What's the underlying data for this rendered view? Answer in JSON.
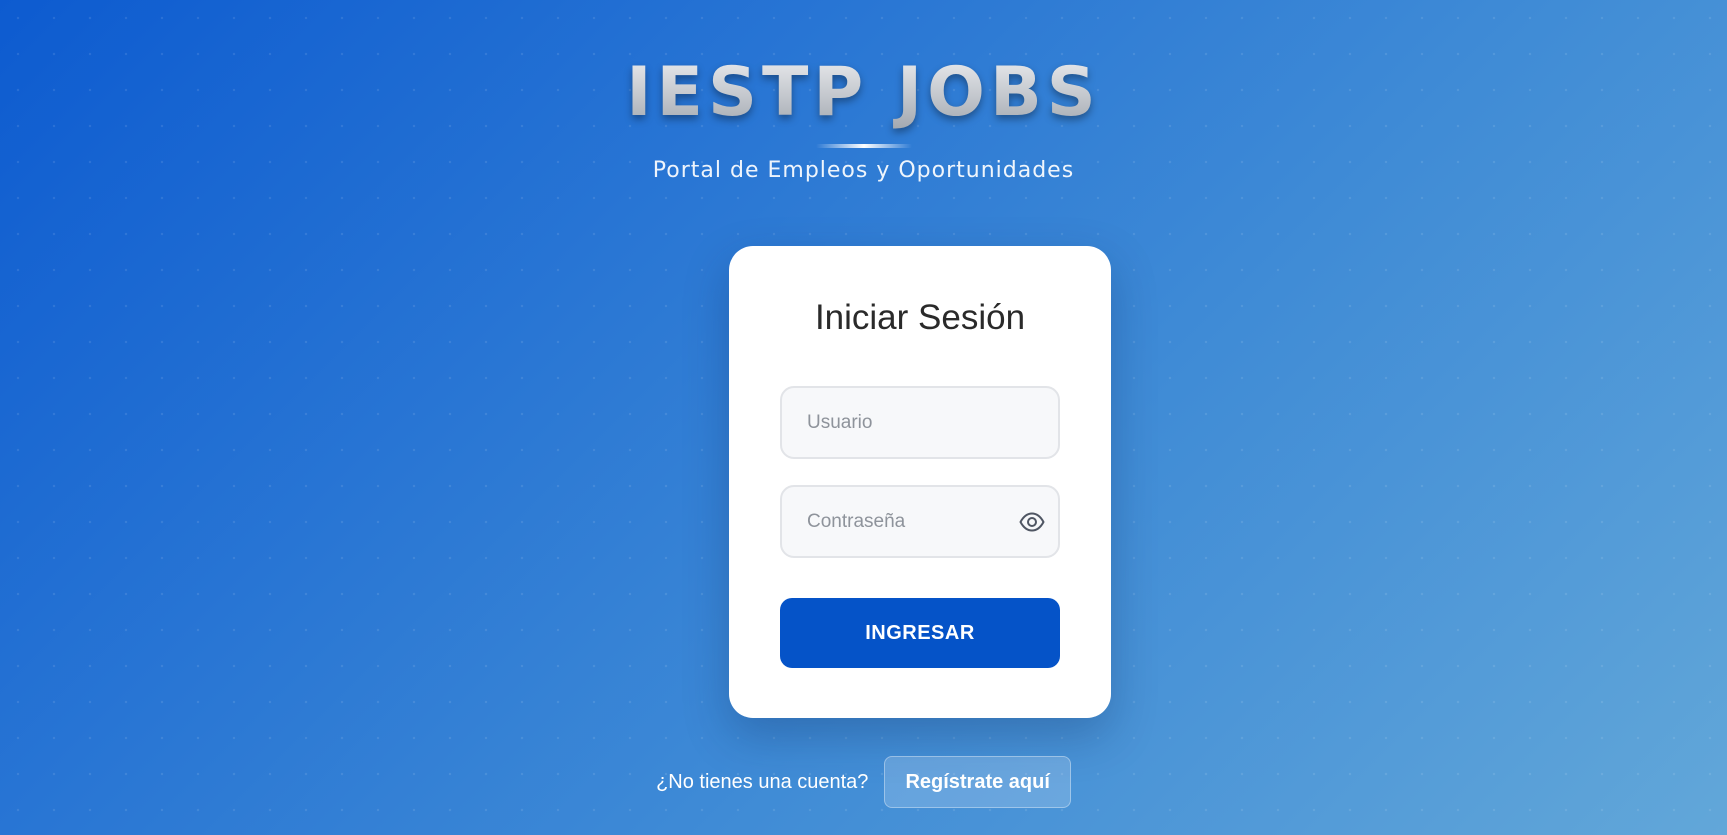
{
  "brand": {
    "title": "IESTP JOBS",
    "subtitle": "Portal de Empleos y Oportunidades"
  },
  "login": {
    "title": "Iniciar Sesión",
    "username_placeholder": "Usuario",
    "password_placeholder": "Contraseña",
    "show_password_icon": "eye-icon",
    "submit_label": "INGRESAR"
  },
  "register": {
    "prompt": "¿No tienes una cuenta?",
    "link_label": "Regístrate aquí"
  },
  "colors": {
    "primary_button": "#0553c8",
    "background_start": "#0d5bd0",
    "background_end": "#62a7d9",
    "card_background": "#ffffff",
    "title_text": "#2a2a2a"
  }
}
